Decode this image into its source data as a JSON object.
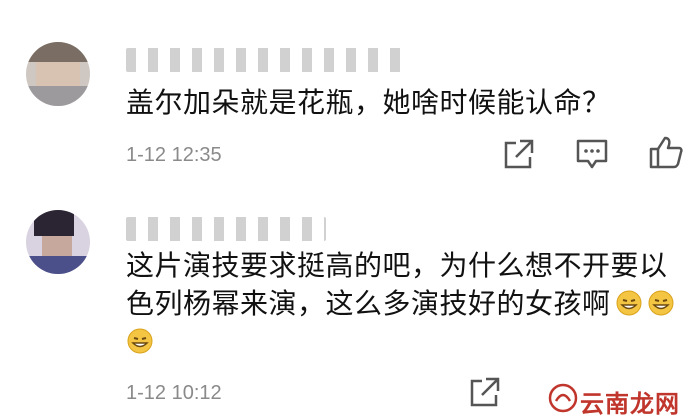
{
  "comments": [
    {
      "text": "盖尔加朵就是花瓶，她啥时候能认命？",
      "time": "1-12 12:35"
    },
    {
      "text_line1": "这片演技要求挺高的吧，为什么想不开要以",
      "text_line2": "色列杨幂来演，这么多演技好的女孩啊",
      "time": "1-12 10:12"
    }
  ],
  "icons": {
    "share": "share-icon",
    "comment": "comment-icon",
    "like": "thumbs-up-icon",
    "emoji": "grin-emoji"
  },
  "watermark": {
    "text": "云南龙网"
  },
  "colors": {
    "text": "#111111",
    "time": "#8a8a8a",
    "watermark": "#c0362c"
  }
}
